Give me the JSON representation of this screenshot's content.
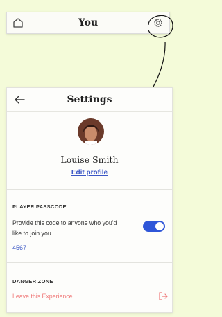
{
  "topbar": {
    "title": "You",
    "home_icon": "home-icon",
    "settings_icon": "gear-icon"
  },
  "settings": {
    "title": "Settings",
    "back_icon": "arrow-left-icon",
    "user_name": "Louise Smith",
    "edit_profile_label": "Edit profile",
    "passcode_section_label": "PLAYER PASSCODE",
    "passcode_description": "Provide this code to anyone who you'd like to join you",
    "passcode_enabled": true,
    "passcode": "4567",
    "danger_section_label": "DANGER ZONE",
    "leave_label": "Leave this Experience",
    "leave_icon": "exit-icon"
  },
  "colors": {
    "background": "#f4fbd9",
    "accent": "#2f56d8",
    "danger": "#f07a7a"
  }
}
